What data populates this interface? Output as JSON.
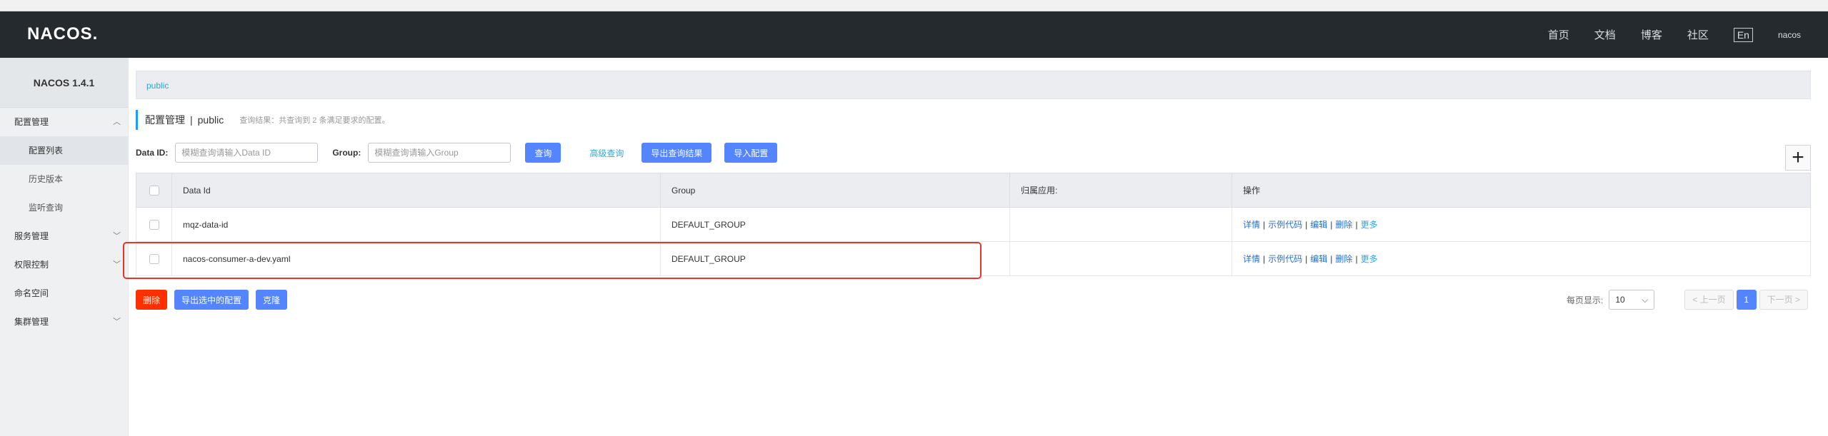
{
  "header": {
    "logo": "NACOS.",
    "nav": [
      "首页",
      "文档",
      "博客",
      "社区"
    ],
    "lang": "En",
    "user": "nacos"
  },
  "sidebar": {
    "version": "NACOS 1.4.1",
    "config_group": "配置管理",
    "config_items": [
      "配置列表",
      "历史版本",
      "监听查询"
    ],
    "groups": [
      "服务管理",
      "权限控制",
      "命名空间",
      "集群管理"
    ]
  },
  "breadcrumb": "public",
  "title": {
    "main": "配置管理",
    "separator": "|",
    "namespace": "public",
    "hint": "查询结果：共查询到 2 条满足要求的配置。"
  },
  "filters": {
    "data_id_label": "Data ID:",
    "data_id_placeholder": "模糊查询请输入Data ID",
    "group_label": "Group:",
    "group_placeholder": "模糊查询请输入Group",
    "search": "查询",
    "advanced": "高级查询",
    "export_results": "导出查询结果",
    "import": "导入配置"
  },
  "table": {
    "headers": [
      "Data Id",
      "Group",
      "归属应用:",
      "操作"
    ],
    "rows": [
      {
        "data_id": "mqz-data-id",
        "group": "DEFAULT_GROUP",
        "app": ""
      },
      {
        "data_id": "nacos-consumer-a-dev.yaml",
        "group": "DEFAULT_GROUP",
        "app": ""
      }
    ],
    "ops": [
      "详情",
      "示例代码",
      "编辑",
      "删除",
      "更多"
    ]
  },
  "actions": {
    "delete": "删除",
    "export_selected": "导出选中的配置",
    "clone": "克隆"
  },
  "pager": {
    "per_page_label": "每页显示:",
    "per_page": "10",
    "prev": "< 上一页",
    "current": "1",
    "next": "下一页 >"
  },
  "colors": {
    "primary": "#5584ff",
    "danger": "#ff3000",
    "topbar": "#252a2f",
    "link": "#2aa8d8",
    "highlight": "#e8352c"
  }
}
